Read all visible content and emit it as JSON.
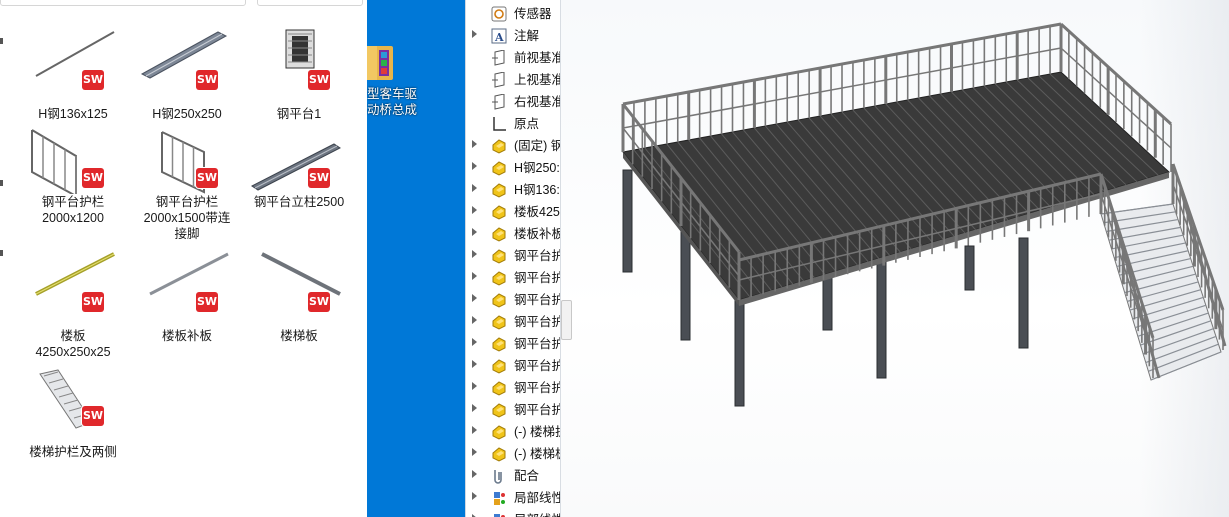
{
  "explorer": {
    "items": [
      {
        "caption": "H钢136x125",
        "icon": "steel-bar-thumbnail"
      },
      {
        "caption": "H钢250x250",
        "icon": "h-beam-thumbnail"
      },
      {
        "caption": "钢平台1",
        "icon": "platform-assembly-thumbnail"
      },
      {
        "caption": "钢平台护栏\n2000x1200",
        "icon": "railing-thumbnail"
      },
      {
        "caption": "钢平台护栏\n2000x1500带连\n接脚",
        "icon": "railing-with-feet-thumbnail"
      },
      {
        "caption": "钢平台立柱2500",
        "icon": "column-thumbnail"
      },
      {
        "caption": "楼板\n4250x250x25",
        "icon": "floor-plate-thumbnail"
      },
      {
        "caption": "楼板补板",
        "icon": "filler-plate-thumbnail"
      },
      {
        "caption": "楼梯板",
        "icon": "stair-plate-thumbnail"
      },
      {
        "caption": "楼梯护栏及两侧",
        "icon": "stair-railing-thumbnail"
      }
    ],
    "badge_text": "SW",
    "badge_color": "#e0282b"
  },
  "desktop": {
    "background": "#0078d7",
    "shortcut_label": "型客车驱\n动桥总成"
  },
  "tree": {
    "items": [
      {
        "label": "传感器",
        "icon": "sensor-icon",
        "expandable": false
      },
      {
        "label": "注解",
        "icon": "annotation-icon",
        "expandable": true
      },
      {
        "label": "前视基准",
        "icon": "plane-icon",
        "expandable": false
      },
      {
        "label": "上视基准",
        "icon": "plane-icon",
        "expandable": false
      },
      {
        "label": "右视基准",
        "icon": "plane-icon",
        "expandable": false
      },
      {
        "label": "原点",
        "icon": "origin-icon",
        "expandable": false
      },
      {
        "label": "(固定) 钢",
        "icon": "part-icon",
        "expandable": true
      },
      {
        "label": "H钢250:",
        "icon": "part-icon",
        "expandable": true
      },
      {
        "label": "H钢136:",
        "icon": "part-icon",
        "expandable": true
      },
      {
        "label": "楼板425",
        "icon": "part-icon",
        "expandable": true
      },
      {
        "label": "楼板补板",
        "icon": "part-icon",
        "expandable": true
      },
      {
        "label": "钢平台护",
        "icon": "part-icon",
        "expandable": true
      },
      {
        "label": "钢平台护",
        "icon": "part-icon",
        "expandable": true
      },
      {
        "label": "钢平台护",
        "icon": "part-icon",
        "expandable": true
      },
      {
        "label": "钢平台护",
        "icon": "part-icon",
        "expandable": true
      },
      {
        "label": "钢平台护",
        "icon": "part-icon",
        "expandable": true
      },
      {
        "label": "钢平台护",
        "icon": "part-icon",
        "expandable": true
      },
      {
        "label": "钢平台护",
        "icon": "part-icon",
        "expandable": true
      },
      {
        "label": "钢平台护",
        "icon": "part-icon",
        "expandable": true
      },
      {
        "label": "(-) 楼梯护",
        "icon": "part-icon",
        "expandable": true
      },
      {
        "label": "(-) 楼梯板",
        "icon": "part-icon",
        "expandable": true
      },
      {
        "label": "配合",
        "icon": "mates-icon",
        "expandable": true
      },
      {
        "label": "局部线性",
        "icon": "pattern-icon",
        "expandable": true
      },
      {
        "label": "局部线性",
        "icon": "pattern-icon",
        "expandable": true
      }
    ]
  },
  "viewport": {
    "model_name": "钢平台1",
    "model_color": "#777777",
    "deck_color": "#3a3a3a"
  }
}
